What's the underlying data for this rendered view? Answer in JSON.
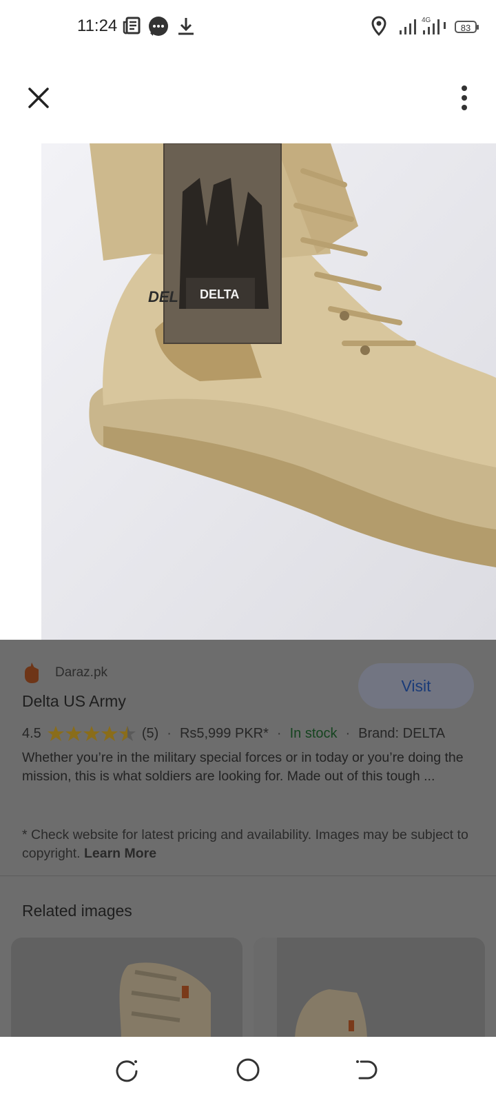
{
  "status_bar": {
    "time": "11:24",
    "battery": "83",
    "network": "4G",
    "icons": [
      "news-icon",
      "message-icon",
      "download-icon",
      "location-icon",
      "signal-icon",
      "battery-icon"
    ]
  },
  "topbar": {
    "icons": [
      "close-icon",
      "more-vert-icon"
    ]
  },
  "result": {
    "source": "Daraz.pk",
    "source_icon": "daraz-logo-icon",
    "visit_label": "Visit",
    "title": "Delta US Army",
    "rating": "4.5",
    "rating_value": 4.5,
    "rating_max": 5,
    "review_count": "(5)",
    "price": "Rs5,999 PKR*",
    "stock": "In stock",
    "brand": "Brand: DELTA",
    "description": "Whether you’re in the military special forces or in today or you’re doing the mission, this is what soldiers are looking for. Made out of this tough ...",
    "disclaimer": "* Check website for latest pricing and availability. Images may be subject to copyright.",
    "learn_more": "Learn More"
  },
  "related": {
    "title": "Related images"
  },
  "navbar": {
    "icons": [
      "recent-apps-icon",
      "home-icon",
      "back-icon"
    ]
  },
  "colors": {
    "stock_green": "#15441f",
    "visit_text": "#1a3b78",
    "star_gold": "#8a6d1a",
    "scrim": "#6d6d6d"
  }
}
